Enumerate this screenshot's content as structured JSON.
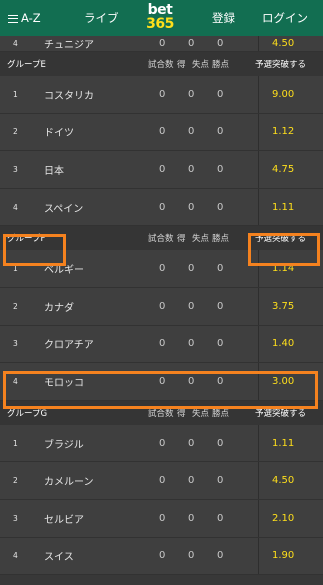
{
  "topbar": {
    "menu_label": "A-Z",
    "live_label": "ライブ",
    "logo_top": "bet",
    "logo_bottom": "365",
    "register_label": "登録",
    "login_label": "ログイン"
  },
  "table_headers": {
    "played": "試合数",
    "goals_for": "得",
    "goals_against": "失点",
    "points": "勝点",
    "qualify": "予選突破する"
  },
  "partial_row": {
    "pos": "4",
    "team": "チュニジア",
    "played": "0",
    "ga": "0",
    "pts": "0",
    "odds": "4.50"
  },
  "groups": [
    {
      "name": "グループE",
      "teams": [
        {
          "pos": "1",
          "team": "コスタリカ",
          "played": "0",
          "ga": "0",
          "pts": "0",
          "odds": "9.00"
        },
        {
          "pos": "2",
          "team": "ドイツ",
          "played": "0",
          "ga": "0",
          "pts": "0",
          "odds": "1.12"
        },
        {
          "pos": "3",
          "team": "日本",
          "played": "0",
          "ga": "0",
          "pts": "0",
          "odds": "4.75"
        },
        {
          "pos": "4",
          "team": "スペイン",
          "played": "0",
          "ga": "0",
          "pts": "0",
          "odds": "1.11"
        }
      ]
    },
    {
      "name": "グループF",
      "teams": [
        {
          "pos": "1",
          "team": "ベルギー",
          "played": "0",
          "ga": "0",
          "pts": "0",
          "odds": "1.14"
        },
        {
          "pos": "2",
          "team": "カナダ",
          "played": "0",
          "ga": "0",
          "pts": "0",
          "odds": "3.75"
        },
        {
          "pos": "3",
          "team": "クロアチア",
          "played": "0",
          "ga": "0",
          "pts": "0",
          "odds": "1.40"
        },
        {
          "pos": "4",
          "team": "モロッコ",
          "played": "0",
          "ga": "0",
          "pts": "0",
          "odds": "3.00"
        }
      ]
    },
    {
      "name": "グループG",
      "teams": [
        {
          "pos": "1",
          "team": "ブラジル",
          "played": "0",
          "ga": "0",
          "pts": "0",
          "odds": "1.11"
        },
        {
          "pos": "2",
          "team": "カメルーン",
          "played": "0",
          "ga": "0",
          "pts": "0",
          "odds": "4.50"
        },
        {
          "pos": "3",
          "team": "セルビア",
          "played": "0",
          "ga": "0",
          "pts": "0",
          "odds": "2.10"
        },
        {
          "pos": "4",
          "team": "スイス",
          "played": "0",
          "ga": "0",
          "pts": "0",
          "odds": "1.90"
        }
      ]
    }
  ],
  "colors": {
    "header_green": "#126e51",
    "odds_yellow": "#ffdf1b",
    "highlight_orange": "#f5821f",
    "row_bg": "#3f3f3f",
    "group_header_bg": "#353535"
  }
}
